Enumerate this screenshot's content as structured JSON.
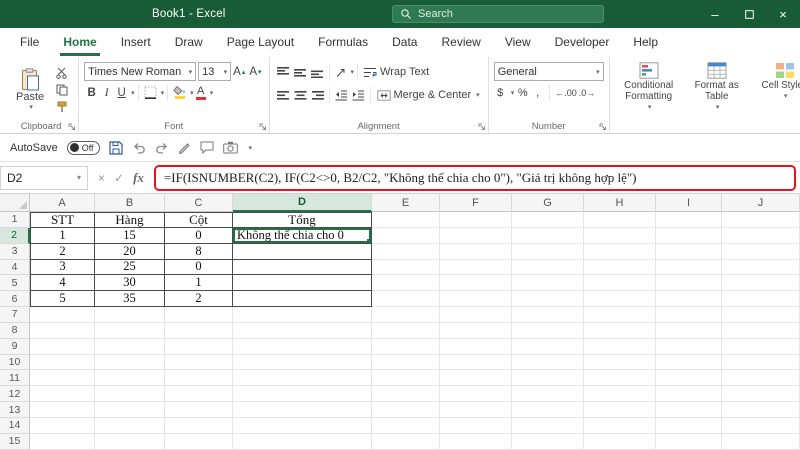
{
  "titlebar": {
    "title": "Book1  -  Excel",
    "search_placeholder": "Search"
  },
  "tabs": {
    "items": [
      "File",
      "Home",
      "Insert",
      "Draw",
      "Page Layout",
      "Formulas",
      "Data",
      "Review",
      "View",
      "Developer",
      "Help"
    ],
    "active": "Home"
  },
  "ribbon": {
    "clipboard": {
      "paste": "Paste",
      "label": "Clipboard"
    },
    "font": {
      "family": "Times New Roman",
      "size": "13",
      "bold": "B",
      "italic": "I",
      "underline": "U",
      "label": "Font"
    },
    "alignment": {
      "wrap_text": "Wrap Text",
      "merge_center": "Merge & Center",
      "label": "Alignment"
    },
    "number": {
      "format": "General",
      "currency": "$",
      "percent": "%",
      "comma": ",",
      "inc_decimal": ".00",
      "dec_decimal": ".0",
      "label": "Number"
    },
    "styles": {
      "conditional_formatting": "Conditional Formatting",
      "format_as_table": "Format as Table",
      "cell_styles": "Cell Styles"
    }
  },
  "quick_access": {
    "autosave_label": "AutoSave",
    "autosave_state": "Off"
  },
  "formula_bar": {
    "name_box": "D2",
    "fx": "fx",
    "formula": "=IF(ISNUMBER(C2), IF(C2<>0, B2/C2, \"Không thể chia cho 0\"), \"Giá trị không hợp lệ\")"
  },
  "grid": {
    "columns": [
      "A",
      "B",
      "C",
      "D",
      "E",
      "F",
      "G",
      "H",
      "I",
      "J"
    ],
    "row_count": 15,
    "selected_cell": "D2",
    "selected_column": "D",
    "selected_row": 2,
    "table": {
      "cells": [
        [
          "STT",
          "Hàng",
          "Cột",
          "Tổng"
        ],
        [
          "1",
          "15",
          "0",
          "Không thể chia cho 0"
        ],
        [
          "2",
          "20",
          "8",
          ""
        ],
        [
          "3",
          "25",
          "0",
          ""
        ],
        [
          "4",
          "30",
          "1",
          ""
        ],
        [
          "5",
          "35",
          "2",
          ""
        ]
      ]
    }
  },
  "colors": {
    "titlebar_green": "#185C37",
    "accent_green": "#217346",
    "selection_border": "#217346",
    "formula_highlight_border": "#E3151B",
    "header_selected_bg": "#D6E8DE"
  }
}
